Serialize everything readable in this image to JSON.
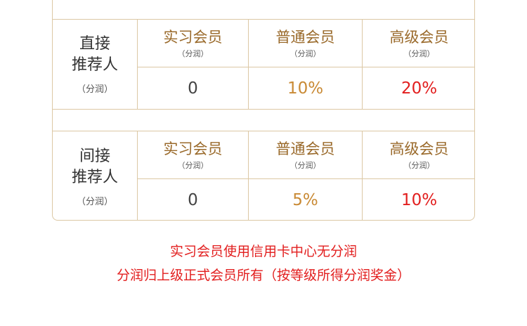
{
  "sections": [
    {
      "label_line1": "直接",
      "label_line2": "推荐人",
      "label_sub": "（分润）",
      "tiers": [
        {
          "name": "实习会员",
          "sub": "（分润）",
          "value": "0",
          "color": "#444444"
        },
        {
          "name": "普通会员",
          "sub": "（分润）",
          "value": "10%",
          "color": "#c98a35"
        },
        {
          "name": "高级会员",
          "sub": "（分润）",
          "value": "20%",
          "color": "#e21e1e"
        }
      ]
    },
    {
      "label_line1": "间接",
      "label_line2": "推荐人",
      "label_sub": "（分润）",
      "tiers": [
        {
          "name": "实习会员",
          "sub": "（分润）",
          "value": "0",
          "color": "#444444"
        },
        {
          "name": "普通会员",
          "sub": "（分润）",
          "value": "5%",
          "color": "#c98a35"
        },
        {
          "name": "高级会员",
          "sub": "（分润）",
          "value": "10%",
          "color": "#e21e1e"
        }
      ]
    }
  ],
  "notes": {
    "line1": "实习会员使用信用卡中心无分润",
    "line2": "分润归上级正式会员所有（按等级所得分润奖金）"
  }
}
